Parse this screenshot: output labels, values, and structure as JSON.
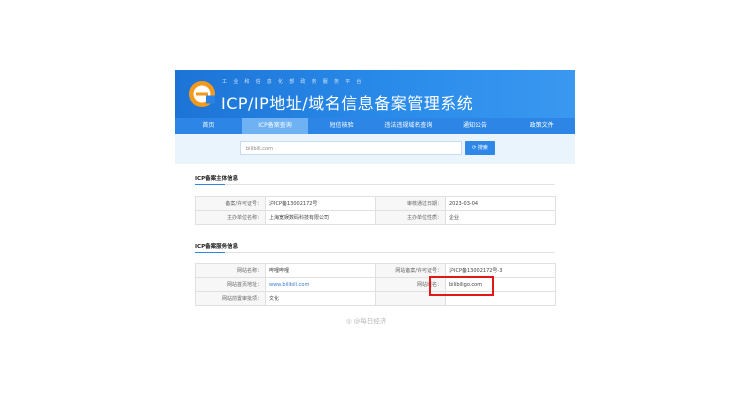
{
  "header": {
    "subtitle": "工业和信息化部政务服务平台",
    "title": "ICP/IP地址/域名信息备案管理系统"
  },
  "nav": {
    "items": [
      {
        "label": "首页"
      },
      {
        "label": "ICP备案查询"
      },
      {
        "label": "短信核验"
      },
      {
        "label": "违法违规域名查询"
      },
      {
        "label": "通知公告"
      },
      {
        "label": "政策文件"
      }
    ],
    "active_index": 1
  },
  "search": {
    "value": "bilibili.com",
    "button_label": "搜索"
  },
  "sponsor_section": {
    "title": "ICP备案主体信息",
    "rows": [
      {
        "label1": "备案/许可证号：",
        "value1": "沪ICP备13002172号",
        "label2": "审核通过日期：",
        "value2": "2023-03-04"
      },
      {
        "label1": "主办单位名称：",
        "value1": "上海宽娱数码科技有限公司",
        "label2": "主办单位性质：",
        "value2": "企业"
      }
    ]
  },
  "service_section": {
    "title": "ICP备案服务信息",
    "rows": [
      {
        "label1": "网站名称：",
        "value1": "哔哩哔哩",
        "label2": "网站备案/许可证号：",
        "value2": "沪ICP备13002172号-3"
      },
      {
        "label1": "网站首页地址：",
        "value1": "www.bilibili.com",
        "label2": "网站域名：",
        "value2": "bilibiligo.com"
      },
      {
        "label1": "网站前置审批项：",
        "value1": "文化",
        "label2": "",
        "value2": ""
      }
    ]
  },
  "watermark": "@每日经济",
  "colors": {
    "header_blue": "#1c74d6",
    "nav_blue": "#2d86e6",
    "active_tab": "#6fb2f4",
    "highlight_red": "#e01818"
  }
}
